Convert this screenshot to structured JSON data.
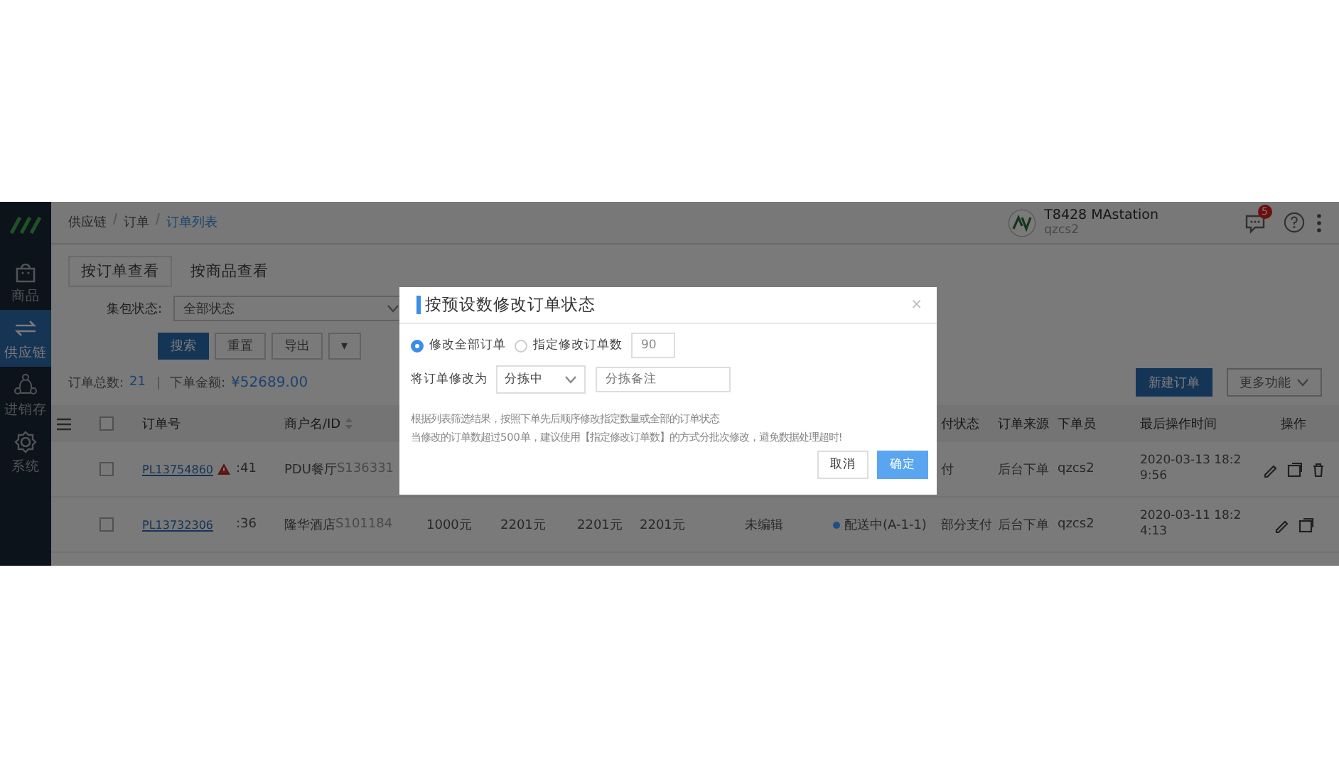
{
  "breadcrumb": [
    {
      "label": "供应链",
      "selected": false
    },
    {
      "label": "订单",
      "selected": false
    },
    {
      "label": "订单列表",
      "selected": true
    }
  ],
  "account": {
    "name": "T8428 MAstation",
    "user": "qzcs2",
    "unread": "5"
  },
  "sidebar": {
    "items": [
      {
        "kind": "bag",
        "label": "商品",
        "selected": false
      },
      {
        "kind": "arrows",
        "label": "供应链",
        "selected": true
      },
      {
        "kind": "cycle",
        "label": "进销存",
        "selected": false
      },
      {
        "kind": "gear",
        "label": "系统",
        "selected": false
      }
    ]
  },
  "tabs": [
    {
      "label": "按订单查看",
      "selected": true
    },
    {
      "label": "按商品查看",
      "selected": false
    }
  ],
  "filter": {
    "label": "集包状态:",
    "value": "全部状态"
  },
  "buttons": [
    {
      "kind": "primary",
      "label": "搜索"
    },
    {
      "kind": "plain",
      "label": "重置"
    },
    {
      "kind": "plain",
      "label": "导出"
    },
    {
      "kind": "caret",
      "label": "▾"
    }
  ],
  "summary": {
    "count_label": "订单总数:",
    "count": "21",
    "amount_label": "下单金额:",
    "amount": "¥52689.00"
  },
  "actions": [
    {
      "kind": "primary",
      "label": "新建订单"
    },
    {
      "kind": "menu",
      "label": "更多功能"
    }
  ],
  "table": {
    "all_checked": false,
    "headers": [
      {
        "label": "订单号",
        "sortable": false
      },
      {
        "label": "商户名/ID",
        "sortable": true
      },
      {
        "label": "付状态",
        "sortable": false
      },
      {
        "label": "订单来源",
        "sortable": false
      },
      {
        "label": "下单员",
        "sortable": false
      },
      {
        "label": "最后操作时间",
        "sortable": false
      },
      {
        "label": "操作",
        "sortable": false
      }
    ],
    "rows": [
      {
        "checked": false,
        "order": "PL13754860",
        "warning": true,
        "time": ":41",
        "merchant": "PDU餐厅",
        "merchant_id": "S136331",
        "pay_status": "付",
        "source": "后台下单",
        "placer": "qzcs2",
        "updated": "2020-03-13 18:29:56",
        "actions": [
          {
            "kind": "edit"
          },
          {
            "kind": "copy"
          },
          {
            "kind": "delete"
          }
        ]
      },
      {
        "checked": false,
        "order": "PL13732306",
        "warning": false,
        "time": ":36",
        "merchant": "隆华酒店",
        "merchant_id": "S101184",
        "amounts": [
          "1000元",
          "2201元",
          "2201元",
          "2201元"
        ],
        "edit_status": "未编辑",
        "delivery": {
          "label": "配送中(A-1-1)",
          "color": "#1d4f86"
        },
        "pay_status": "部分支付",
        "source": "后台下单",
        "placer": "qzcs2",
        "updated": "2020-03-11 18:24:13",
        "actions": [
          {
            "kind": "edit"
          },
          {
            "kind": "copy"
          }
        ]
      }
    ]
  },
  "dialog": {
    "title": "按预设数修改订单状态",
    "close": "×",
    "scopes": [
      {
        "label": "修改全部订单",
        "selected": true
      },
      {
        "label": "指定修改订单数",
        "selected": false
      }
    ],
    "count": "90",
    "status_label": "将订单修改为",
    "status": "分拣中",
    "remark_placeholder": "分拣备注",
    "notes": [
      "根据列表筛选结果，按照下单先后顺序修改指定数量或全部的订单状态",
      "当修改的订单数超过500单，建议使用【指定修改订单数】的方式分批次修改，避免数据处理超时!"
    ],
    "buttons": [
      {
        "kind": "plain",
        "label": "取消"
      },
      {
        "kind": "primary",
        "label": "确定"
      }
    ]
  }
}
